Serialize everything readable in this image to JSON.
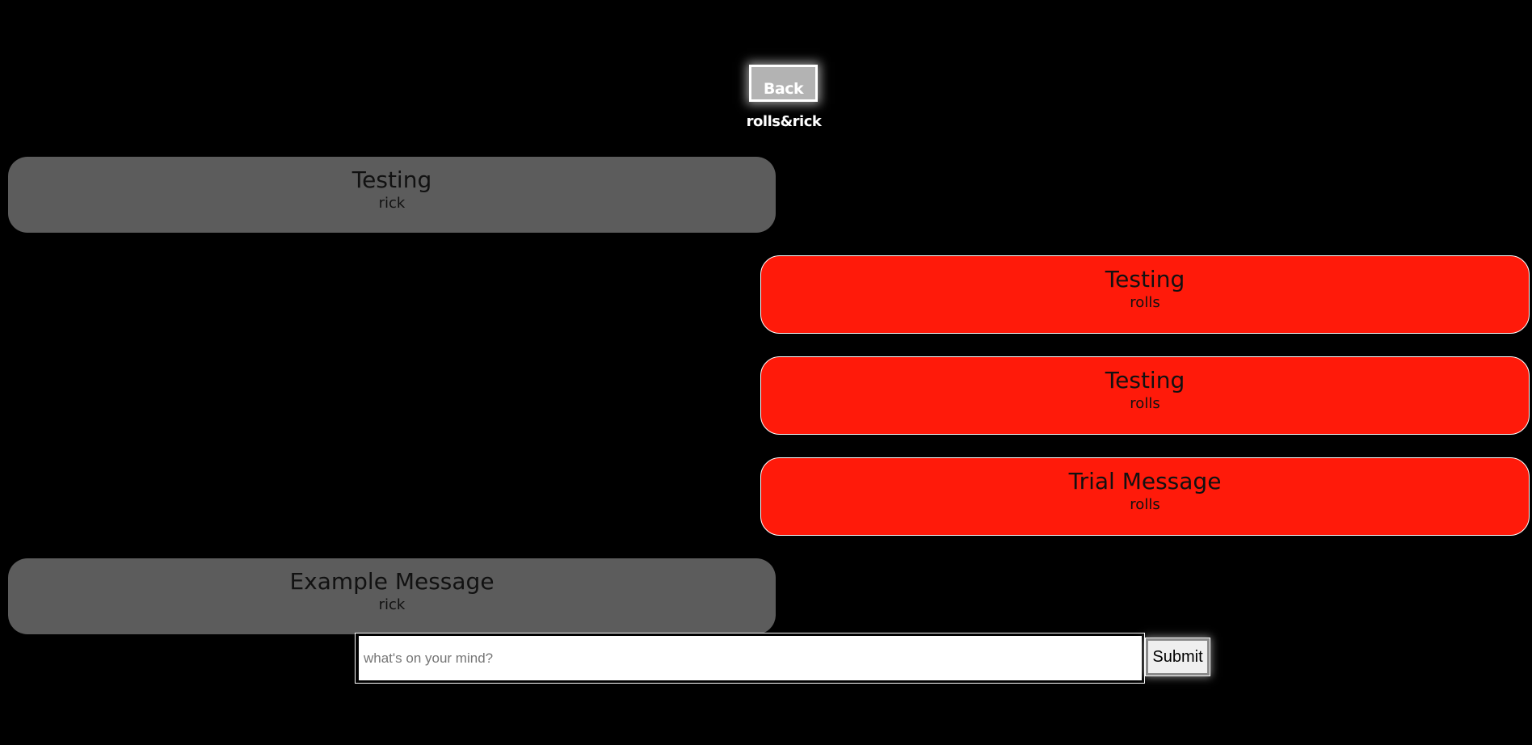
{
  "header": {
    "back_label": "Back",
    "chat_title": "rolls&rick"
  },
  "messages": [
    {
      "text": "Testing",
      "author": "rick",
      "side": "left"
    },
    {
      "text": "Testing",
      "author": "rolls",
      "side": "right"
    },
    {
      "text": "Testing",
      "author": "rolls",
      "side": "right"
    },
    {
      "text": "Trial Message",
      "author": "rolls",
      "side": "right"
    },
    {
      "text": "Example Message",
      "author": "rick",
      "side": "left"
    }
  ],
  "composer": {
    "value": "",
    "placeholder": "what's on your mind?",
    "submit_label": "Submit"
  },
  "colors": {
    "background": "#000000",
    "other_user_bubble": "#5c5c5c",
    "self_bubble": "#ff1a0a",
    "button_gray": "#b3b3b3"
  }
}
